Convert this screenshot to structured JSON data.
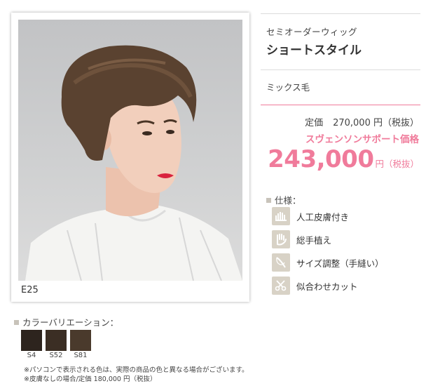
{
  "product": {
    "code": "E25",
    "category": "セミオーダーウィッグ",
    "name": "ショートスタイル",
    "hair_type": "ミックス毛"
  },
  "pricing": {
    "regular_label": "定価",
    "regular_value": "270,000 円（税抜）",
    "sale_label": "スヴェンソンサポート価格",
    "sale_value": "243,000",
    "sale_unit": "円（税抜）"
  },
  "specs": {
    "heading": "仕様：",
    "items": [
      {
        "label": "人工皮膚付き",
        "icon": "artificial-skin-icon"
      },
      {
        "label": "総手植え",
        "icon": "hand-icon"
      },
      {
        "label": "サイズ調整（手縫い）",
        "icon": "needle-icon"
      },
      {
        "label": "似合わせカット",
        "icon": "scissors-icon"
      }
    ]
  },
  "colors": {
    "heading": "カラーバリエーション：",
    "swatches": [
      {
        "label": "S4",
        "color": "#2d241e"
      },
      {
        "label": "S52",
        "color": "#3b2e24"
      },
      {
        "label": "S81",
        "color": "#4a3a2c"
      }
    ]
  },
  "notes": {
    "line1": "※パソコンで表示される色は、実際の商品の色と異なる場合がございます。",
    "line2": "※皮膚なしの場合/定価 180,000 円（税抜）"
  },
  "theme": {
    "accent": "#f07b9b",
    "icon_bg": "#d8d2c6"
  }
}
